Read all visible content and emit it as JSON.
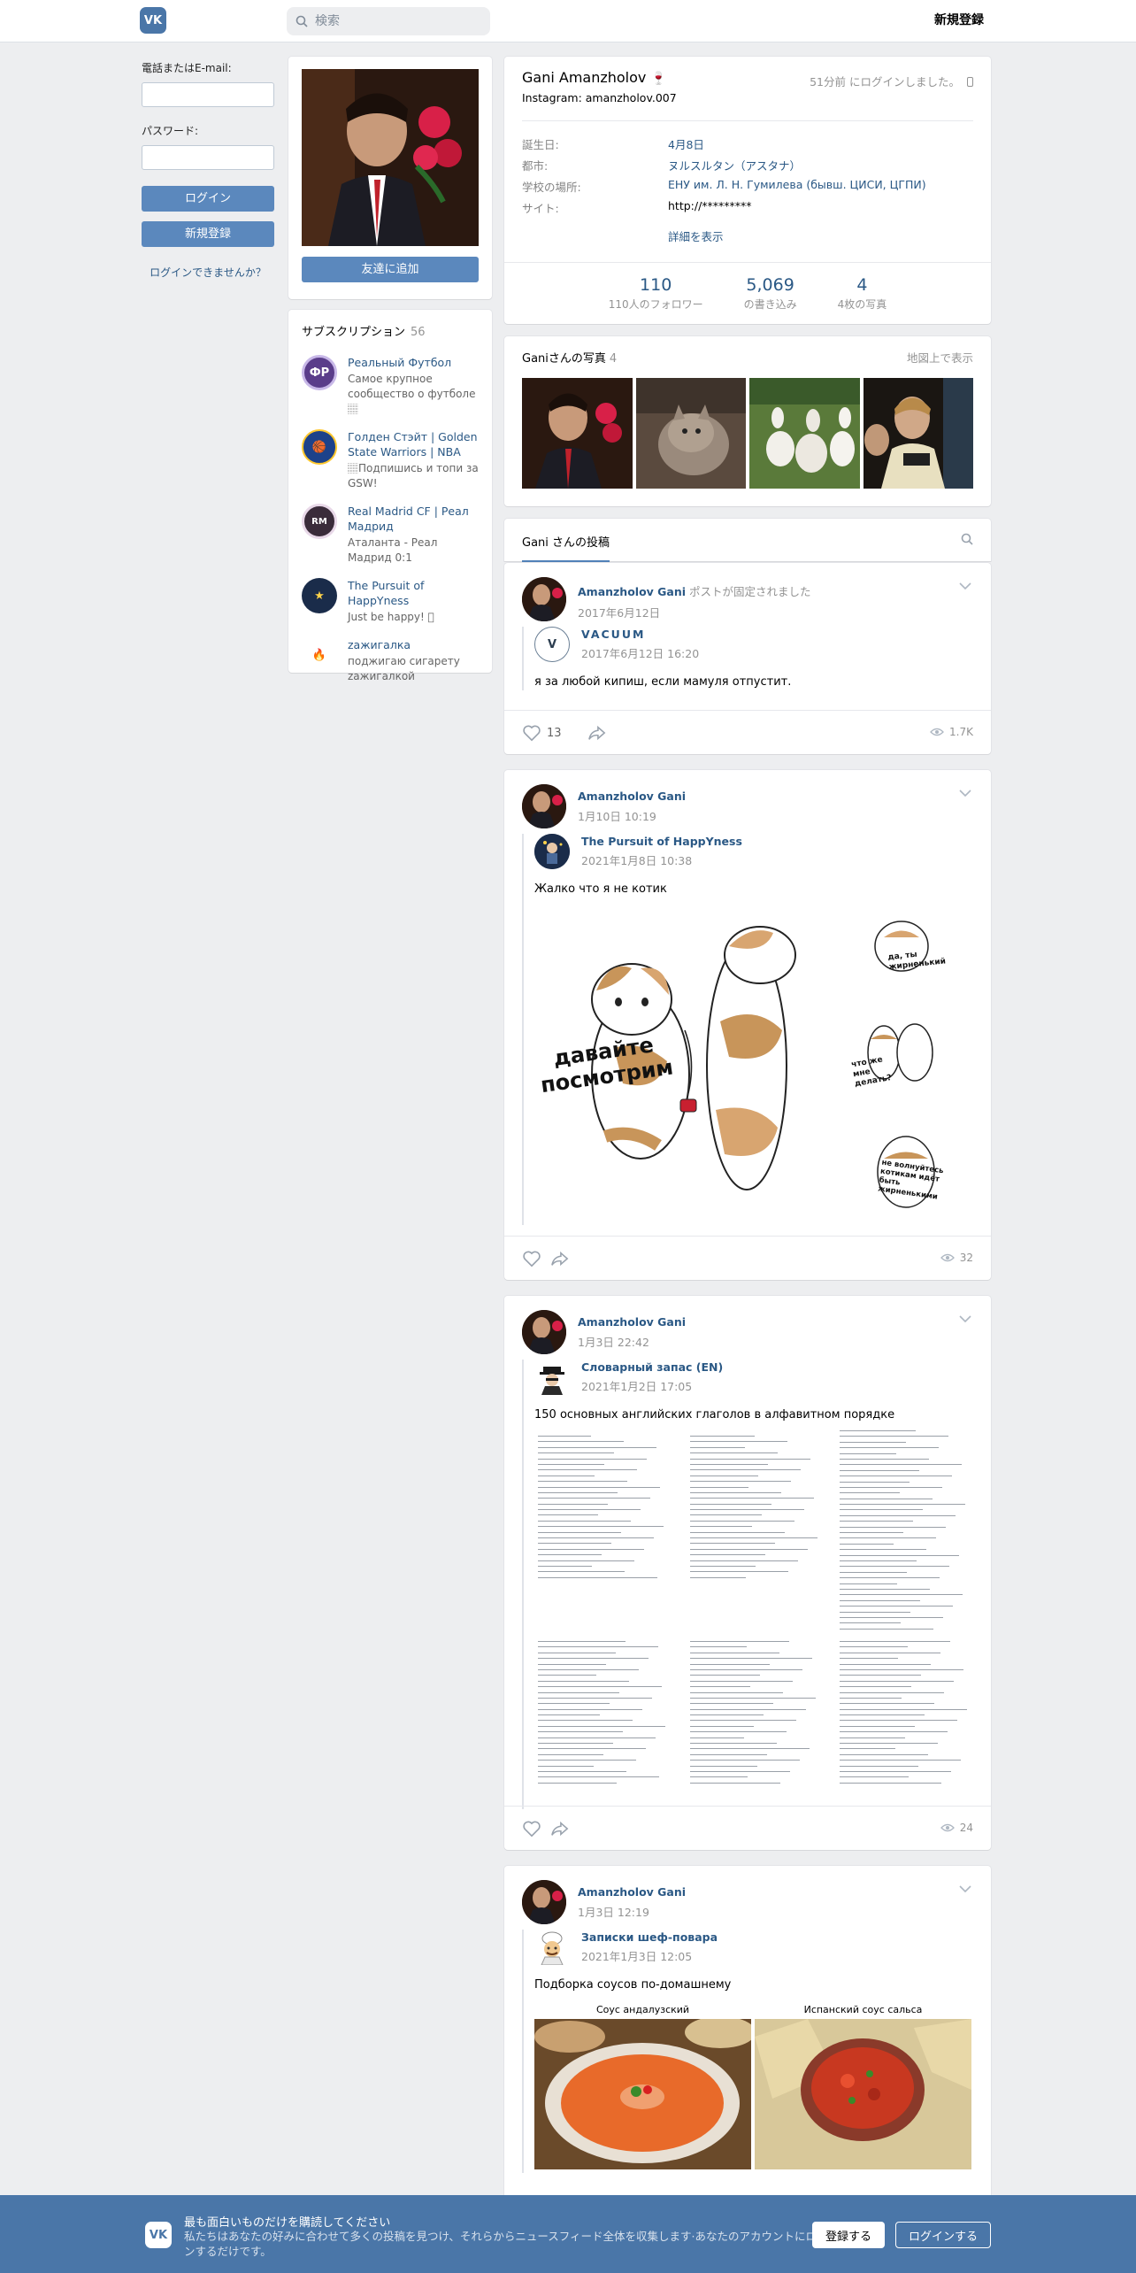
{
  "topbar": {
    "logo": "VK",
    "search_placeholder": "検索",
    "register": "新規登録"
  },
  "login": {
    "email_label": "電話またはE-mail:",
    "password_label": "パスワード:",
    "login_button": "ログイン",
    "register_button": "新規登録",
    "forgot": "ログインできませんか？"
  },
  "profile": {
    "add_friend": "友達に追加",
    "name": "Gani Amanzholov",
    "name_emoji": "🍷",
    "instagram": "Instagram: amanzholov.007",
    "last_seen": "51分前 にログインしました。",
    "info": [
      {
        "label": "誕生日:",
        "value": "4月8日"
      },
      {
        "label": "都市:",
        "value": "ヌルスルタン（アスタナ）"
      },
      {
        "label": "学校の場所:",
        "value": "ЕНУ им. Л. Н. Гумилева (бывш. ЦИСИ, ЦГПИ)"
      },
      {
        "label": "サイト:",
        "value": "http://*********"
      }
    ],
    "more": "詳細を表示",
    "stats": [
      {
        "num": "110",
        "label": "110人のフォロワー"
      },
      {
        "num": "5,069",
        "label": "の書き込み"
      },
      {
        "num": "4",
        "label": "4枚の写真"
      }
    ]
  },
  "subscriptions": {
    "title": "サブスクリプション",
    "count": "56",
    "items": [
      {
        "name": "Реальный Футбол",
        "desc": "Самое крупное сообщество о футболе 🏽",
        "icon": "ФР",
        "color": "#5a3d8a"
      },
      {
        "name": "Голден Стэйт | Golden State Warriors | NBA",
        "desc": "🏽Подпишись и топи за GSW!",
        "icon": "🏀",
        "color": "#1d428a"
      },
      {
        "name": "Real Madrid CF | Реал Мадрид",
        "desc": "Аталанта - Реал Мадрид 0:1",
        "icon": "RM",
        "color": "#3a2c3a"
      },
      {
        "name": "The Pursuit of HappYness",
        "desc": "Just be happy! 🏽",
        "icon": "★",
        "color": "#1a2c4a"
      },
      {
        "name": "zажигалка",
        "desc": "поджигаю сигарету zажигалкой",
        "icon": "🔥",
        "color": "#ffffff"
      }
    ]
  },
  "photos": {
    "title": "Ganiさんの写真",
    "count": "4",
    "map": "地図上で表示"
  },
  "wall": {
    "tab": "Gani さんの投稿",
    "posts": [
      {
        "author": "Amanzholov Gani",
        "fixed": "ポストが固定されました",
        "date": "2017年6月12日",
        "repost_name": "VACUUM",
        "repost_date": "2017年6月12日 16:20",
        "text": "я за любой кипиш, если мамуля отпустит.",
        "likes": "13",
        "views": "1.7K"
      },
      {
        "author": "Amanzholov Gani",
        "date": "1月10日 10:19",
        "repost_name": "The Pursuit of HappYness",
        "repost_date": "2021年1月8日 10:38",
        "text": "Жалко что я не котик",
        "img_big": "давайте посмотрим",
        "img_s1": "да, ты жирненький",
        "img_s2": "что же мне делать?",
        "img_s3": "не волнуйтесь котикам идёт быть жирненькими",
        "views": "32"
      },
      {
        "author": "Amanzholov Gani",
        "date": "1月3日 22:42",
        "repost_name": "Словарный запас (EN)",
        "repost_date": "2021年1月2日 17:05",
        "text": "150 основных английских глаголов в алфавитном порядке",
        "views": "24"
      },
      {
        "author": "Amanzholov Gani",
        "date": "1月3日 12:19",
        "repost_name": "Записки шеф-повара",
        "repost_date": "2021年1月3日 12:05",
        "text": "Подборка соусов по-домашнему",
        "sauce1": "Соус андалузский",
        "sauce2": "Испанский соус сальса"
      }
    ]
  },
  "banner": {
    "title": "最も面白いものだけを購読してください",
    "text": "私たちはあなたの好みに合わせて多くの投稿を見つけ、それらからニュースフィード全体を収集します·あなたのアカウントにログインするだけです。",
    "register": "登録する",
    "login": "ログインする"
  }
}
